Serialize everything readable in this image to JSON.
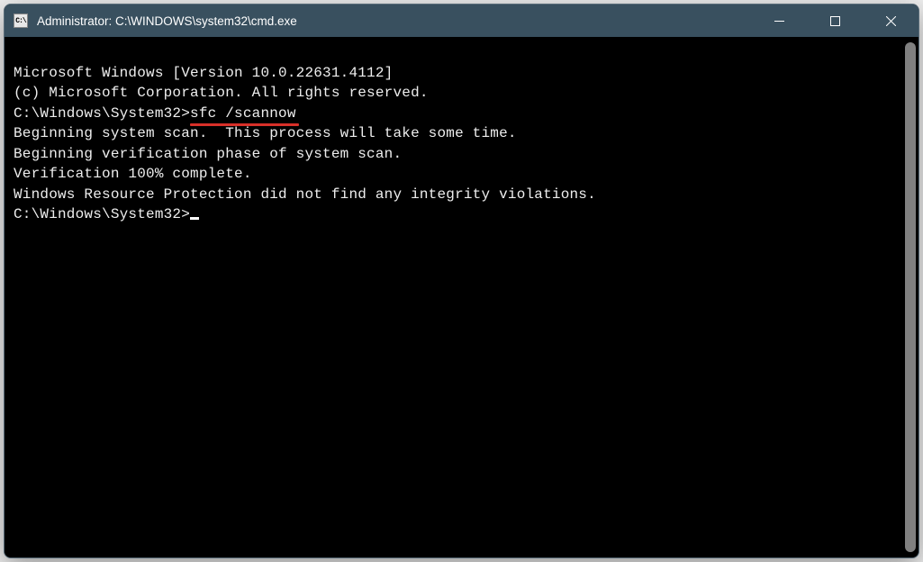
{
  "titlebar": {
    "icon_label": "C:\\",
    "title": "Administrator: C:\\WINDOWS\\system32\\cmd.exe"
  },
  "console": {
    "line1": "Microsoft Windows [Version 10.0.22631.4112]",
    "line2": "(c) Microsoft Corporation. All rights reserved.",
    "blank1": "",
    "prompt1": "C:\\Windows\\System32>",
    "command1": "sfc /scannow",
    "blank2": "",
    "line3": "Beginning system scan.  This process will take some time.",
    "blank3": "",
    "line4": "Beginning verification phase of system scan.",
    "line5": "Verification 100% complete.",
    "blank4": "",
    "line6": "Windows Resource Protection did not find any integrity violations.",
    "blank5": "",
    "prompt2": "C:\\Windows\\System32>"
  }
}
